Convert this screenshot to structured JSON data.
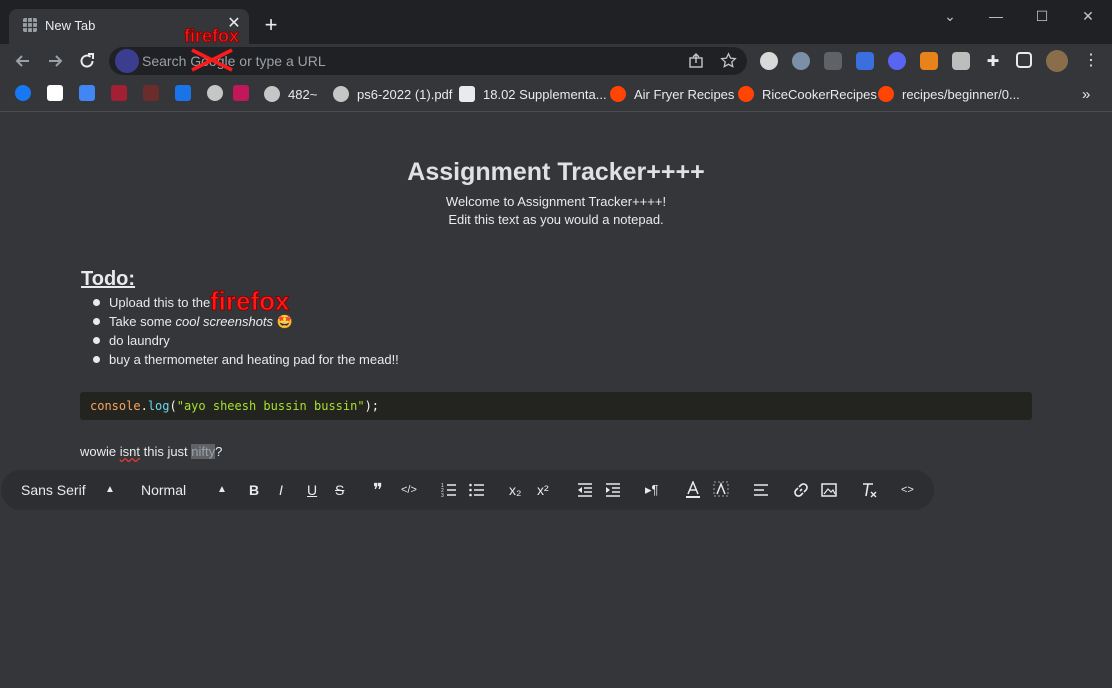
{
  "browser": {
    "tab_title": "New Tab",
    "omnibox_placeholder": "Search Google or type a URL",
    "bookmarks": [
      {
        "label": "482~",
        "icon": "globe-icon"
      },
      {
        "label": "ps6-2022 (1).pdf",
        "icon": "globe-icon"
      },
      {
        "label": "18.02 Supplementa...",
        "icon": "mit-icon"
      },
      {
        "label": "Air Fryer Recipes",
        "icon": "reddit-icon"
      },
      {
        "label": "RiceCookerRecipes",
        "icon": "reddit-icon"
      },
      {
        "label": "recipes/beginner/0...",
        "icon": "reddit-icon"
      }
    ],
    "more_bookmarks": "»",
    "colors": {
      "reddit": "#ff4500",
      "firefox_label": "#ff1a1a"
    }
  },
  "overlay": {
    "firefox_top": "firefox",
    "firefox_page": "firefox"
  },
  "page": {
    "title": "Assignment Tracker++++",
    "subtitle_1": "Welcome to Assignment Tracker++++!",
    "subtitle_2": "Edit this text as you would a notepad.",
    "todo_heading": "Todo:",
    "todo_items": [
      {
        "a": "Upload this to the ",
        "b": "",
        "c": ""
      },
      {
        "a": "Take some ",
        "b": "cool screenshots",
        "c": " 🤩"
      },
      {
        "a": "do laundry",
        "b": "",
        "c": ""
      },
      {
        "a": "buy a thermometer and heating pad for the mead!!",
        "b": "",
        "c": ""
      }
    ],
    "code": {
      "obj": "console",
      "dot": ".",
      "fn": "log",
      "open": "(",
      "str": "\"ayo sheesh bussin bussin\"",
      "close": ");"
    },
    "wowie": {
      "a": "wowie ",
      "b": "isnt",
      "c": " this just ",
      "d": "nifty",
      "e": "?"
    }
  },
  "editor_toolbar": {
    "font": "Sans Serif",
    "size": "Normal",
    "bold": "B",
    "italic": "I",
    "underline": "U",
    "strike": "S",
    "quote": "❞",
    "code": "</>",
    "subscript": "x₂",
    "superscript": "x²",
    "direction": "▸¶",
    "source": "<>"
  }
}
